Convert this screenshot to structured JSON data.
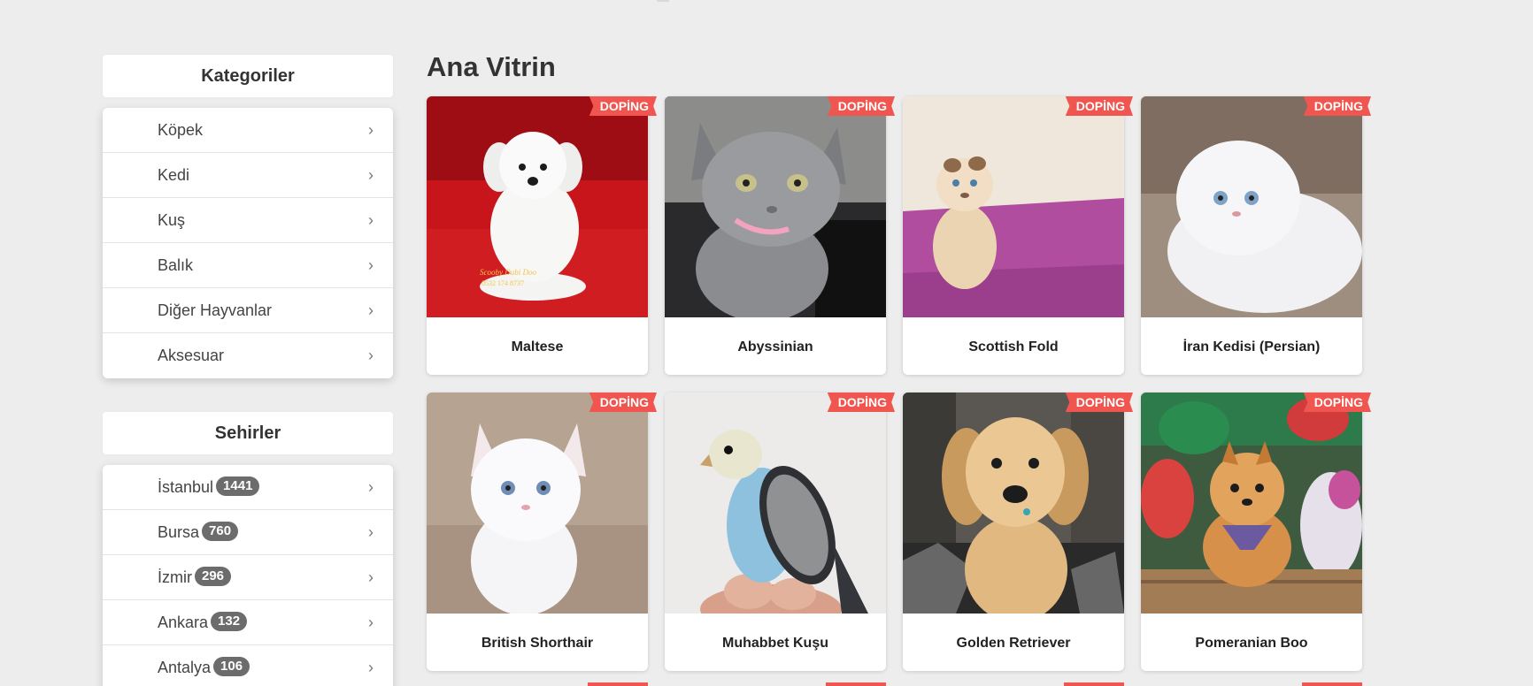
{
  "sidebar": {
    "categories_title": "Kategoriler",
    "categories": [
      {
        "label": "Köpek"
      },
      {
        "label": "Kedi"
      },
      {
        "label": "Kuş"
      },
      {
        "label": "Balık"
      },
      {
        "label": "Diğer Hayvanlar"
      },
      {
        "label": "Aksesuar"
      }
    ],
    "cities_title": "Sehirler",
    "cities": [
      {
        "label": "İstanbul",
        "count": "1441"
      },
      {
        "label": "Bursa",
        "count": "760"
      },
      {
        "label": "İzmir",
        "count": "296"
      },
      {
        "label": "Ankara",
        "count": "132"
      },
      {
        "label": "Antalya",
        "count": "106"
      }
    ],
    "chevron_icon": "chevron-right-icon"
  },
  "main": {
    "title": "Ana Vitrin",
    "badge_label": "DOPİNG",
    "cards": [
      {
        "name": "Maltese",
        "image": "white-maltese-puppy-on-red-sofa"
      },
      {
        "name": "Abyssinian",
        "image": "grey-kitten-pink-collar"
      },
      {
        "name": "Scottish Fold",
        "image": "cream-scottish-fold-kitten"
      },
      {
        "name": "İran Kedisi (Persian)",
        "image": "white-persian-kitten"
      },
      {
        "name": "British Shorthair",
        "image": "white-british-shorthair-kitten"
      },
      {
        "name": "Muhabbet Kuşu",
        "image": "blue-budgie-on-hand"
      },
      {
        "name": "Golden Retriever",
        "image": "golden-retriever-puppy"
      },
      {
        "name": "Pomeranian Boo",
        "image": "pomeranian-with-toys"
      }
    ]
  },
  "colors": {
    "background": "#ededed",
    "badge": "#f0564f",
    "count_badge": "#6c6c6c"
  }
}
